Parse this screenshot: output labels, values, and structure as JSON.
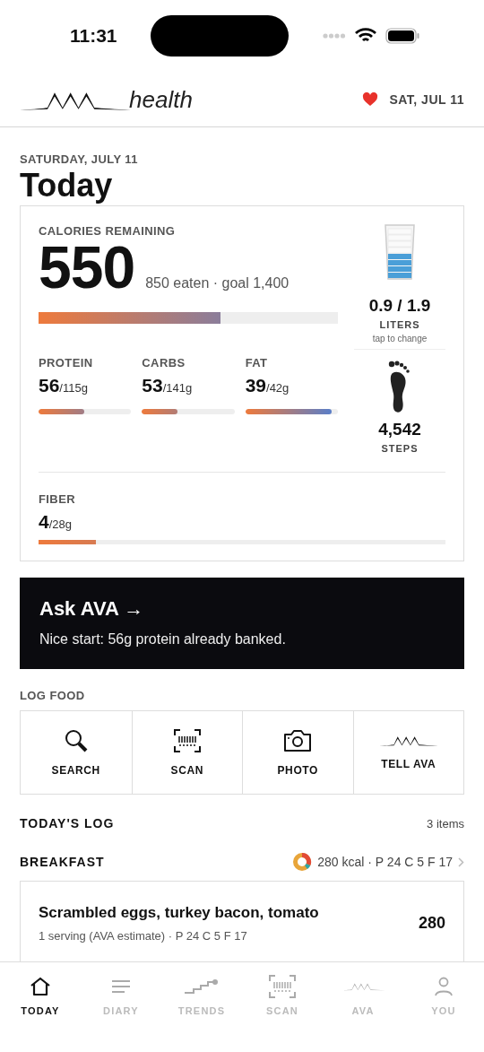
{
  "status_bar": {
    "time": "11:31"
  },
  "header": {
    "brand": "health",
    "date": "SAT, JUL 11"
  },
  "date_label": "SATURDAY, JULY 11",
  "title": "Today",
  "summary": {
    "label": "CALORIES REMAINING",
    "remaining": "550",
    "detail": "850 eaten · goal 1,400",
    "level": 0.607,
    "macros": [
      {
        "name": "PROTEIN",
        "value": "56",
        "goal": "/115g",
        "level": 0.49
      },
      {
        "name": "CARBS",
        "value": "53",
        "goal": "/141g",
        "level": 0.38
      },
      {
        "name": "FAT",
        "value": "39",
        "goal": "/42g",
        "level": 0.93
      }
    ],
    "water": {
      "reading": "0.9 / 1.9",
      "unit": "LITERS",
      "hint": "tap to change"
    },
    "steps": {
      "reading": "4,542",
      "unit": "STEPS"
    },
    "fiber": {
      "name": "FIBER",
      "value": "4",
      "goal": "/28g",
      "level": 0.14
    }
  },
  "ask": {
    "title": "Ask AVA →",
    "message": "Nice start: 56g protein already banked."
  },
  "log_food": {
    "label": "LOG FOOD",
    "actions": [
      {
        "kind": "search",
        "label": "SEARCH"
      },
      {
        "kind": "scan",
        "label": "SCAN"
      },
      {
        "kind": "photo",
        "label": "PHOTO"
      },
      {
        "kind": "ava",
        "label": "TELL AVA"
      }
    ]
  },
  "log": {
    "title": "TODAY'S LOG",
    "count": "3 items",
    "meals": [
      {
        "name": "BREAKFAST",
        "summary": "280 kcal · P 24 C 5 F 17",
        "items": [
          {
            "name": "Scrambled eggs, turkey bacon, tomato",
            "detail": "1 serving (AVA estimate) · P 24 C 5 F 17",
            "kcal": "280"
          }
        ]
      }
    ]
  },
  "tabs": [
    {
      "kind": "home",
      "label": "TODAY",
      "selected": true
    },
    {
      "kind": "diary",
      "label": "DIARY",
      "selected": false
    },
    {
      "kind": "trends",
      "label": "TRENDS",
      "selected": false
    },
    {
      "kind": "scan",
      "label": "SCAN",
      "selected": false
    },
    {
      "kind": "ava",
      "label": "AVA",
      "selected": false
    },
    {
      "kind": "you",
      "label": "YOU",
      "selected": false
    }
  ]
}
